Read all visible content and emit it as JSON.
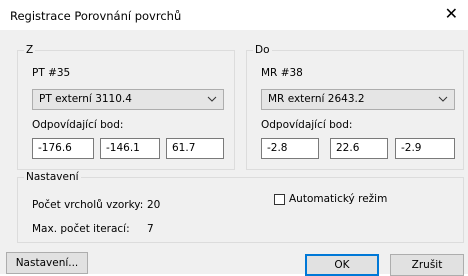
{
  "window": {
    "title": "Registrace Porovnání povrchů"
  },
  "from_group": {
    "legend": "Z",
    "point_label": "PT #35",
    "selected": "PT externí  3110.4",
    "matching_label": "Odpovídající bod:",
    "coords": [
      "-176.6",
      "-146.1",
      "61.7"
    ]
  },
  "to_group": {
    "legend": "Do",
    "point_label": "MR #38",
    "selected": "MR externí  2643.2",
    "matching_label": "Odpovídající bod:",
    "coords": [
      "-2.8",
      "22.6",
      "-2.9"
    ]
  },
  "settings_group": {
    "legend": "Nastavení",
    "vertex_count_label": "Počet vrcholů vzorky:",
    "vertex_count_value": "20",
    "max_iter_label": "Max. počet iterací:",
    "max_iter_value": "7",
    "auto_mode_label": "Automatický režim",
    "auto_mode_checked": false
  },
  "buttons": {
    "settings": "Nastavení...",
    "ok": "OK",
    "cancel": "Zrušit"
  }
}
